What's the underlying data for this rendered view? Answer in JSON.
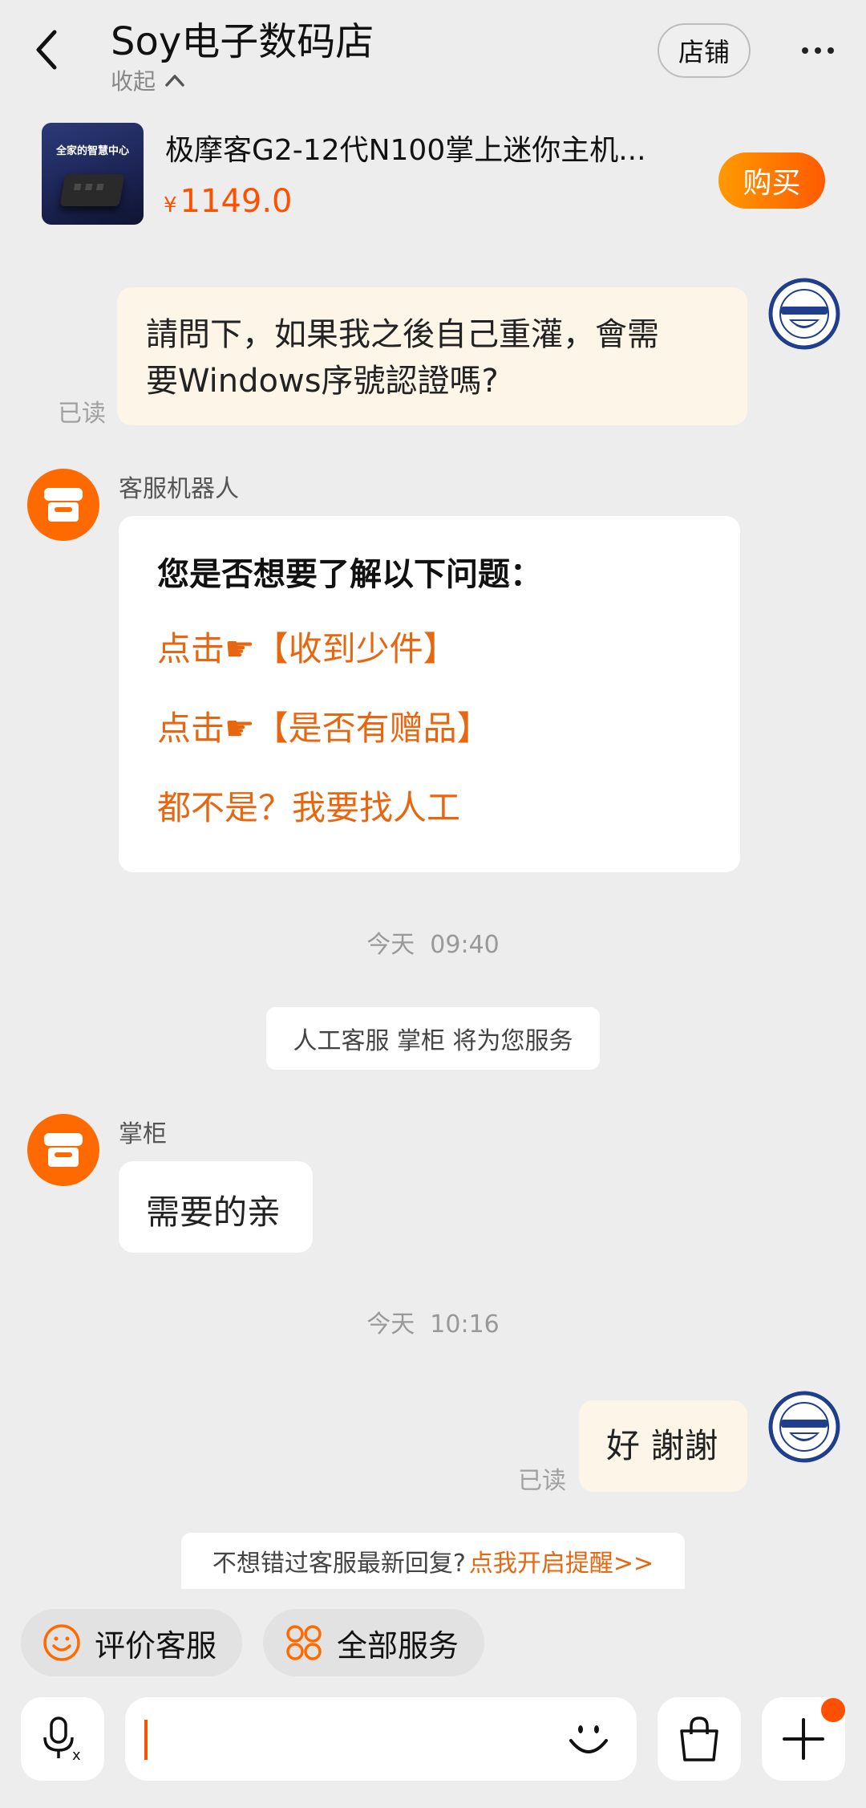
{
  "header": {
    "title": "Soy电子数码店",
    "collapse_label": "收起",
    "store_button": "店铺"
  },
  "product": {
    "image_text": "全家的智慧中心",
    "title": "极摩客G2-12代N100掌上迷你主机...",
    "currency": "¥",
    "price": "1149.0",
    "buy_button": "购买"
  },
  "messages": {
    "m1": {
      "text_line1": "請問下，如果我之後自己重灌，會需",
      "text_line2": "要Windows序號認證嗎?",
      "status": "已读"
    },
    "bot": {
      "sender": "客服机器人",
      "heading": "您是否想要了解以下问题：",
      "options": [
        "点击☛【收到少件】",
        "点击☛【是否有赠品】",
        "都不是？我要找人工"
      ]
    },
    "time1": "今天  09:40",
    "system": "人工客服 掌柜 将为您服务",
    "shop": {
      "sender": "掌柜",
      "text": "需要的亲"
    },
    "time2": "今天  10:16",
    "m2": {
      "text": "好 謝謝",
      "status": "已读"
    }
  },
  "notify": {
    "text": "不想错过客服最新回复?",
    "link": "点我开启提醒>>"
  },
  "quick_actions": [
    {
      "label": "评价客服",
      "icon": "smile-icon"
    },
    {
      "label": "全部服务",
      "icon": "grid-icon"
    }
  ],
  "input": {
    "placeholder": ""
  },
  "colors": {
    "accent": "#ff5000",
    "link": "#e8660f",
    "self_bubble": "#fdf6e8",
    "background": "#ededed"
  }
}
